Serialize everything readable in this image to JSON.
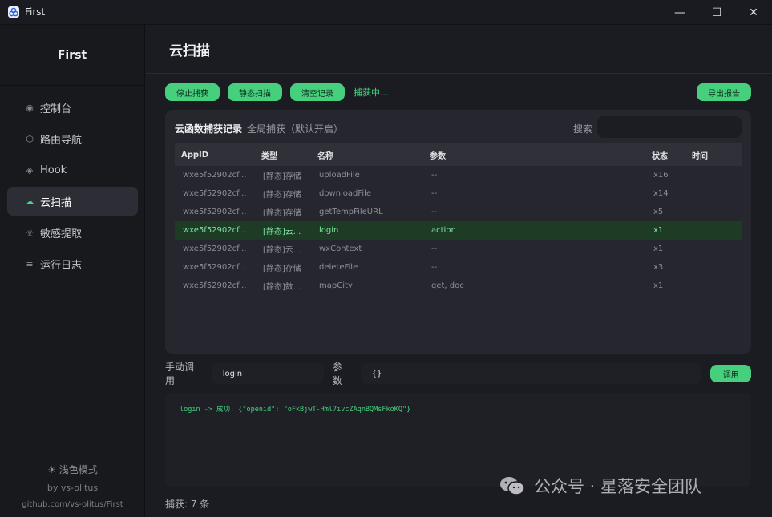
{
  "window": {
    "title": "First",
    "controls": {
      "minimize": "—",
      "maximize": "☐",
      "close": "✕"
    }
  },
  "sidebar": {
    "brand": "First",
    "items": [
      {
        "label": "控制台",
        "icon": "dot-icon",
        "glyph": "◉",
        "active": false
      },
      {
        "label": "路由导航",
        "icon": "hexagon-icon",
        "glyph": "⬡",
        "active": false
      },
      {
        "label": "Hook",
        "icon": "diamond-icon",
        "glyph": "◈",
        "active": false
      },
      {
        "label": "云扫描",
        "icon": "cloud-icon",
        "glyph": "☁",
        "active": true
      },
      {
        "label": "敏感提取",
        "icon": "biohazard-icon",
        "glyph": "☣",
        "active": false
      },
      {
        "label": "运行日志",
        "icon": "list-icon",
        "glyph": "≡",
        "active": false
      }
    ],
    "theme_toggle": "☀  浅色模式",
    "author": "by vs-olitus",
    "repo": "github.com/vs-olitus/First"
  },
  "page": {
    "title": "云扫描",
    "toolbar": {
      "stop": "停止捕获",
      "static_scan": "静态扫描",
      "clear": "清空记录",
      "status": "捕获中...",
      "export": "导出报告"
    },
    "panel": {
      "title": "云函数捕获记录",
      "subtitle": "全局捕获（默认开启）",
      "search_label": "搜索",
      "search_value": ""
    },
    "table": {
      "headers": [
        "AppID",
        "类型",
        "名称",
        "参数",
        "状态",
        "时间"
      ],
      "rows": [
        {
          "appid": "wxe5f52902cf...",
          "type": "[静态]存储",
          "name": "uploadFile",
          "params": "--",
          "status": "x16",
          "time": "",
          "selected": false
        },
        {
          "appid": "wxe5f52902cf...",
          "type": "[静态]存储",
          "name": "downloadFile",
          "params": "--",
          "status": "x14",
          "time": "",
          "selected": false
        },
        {
          "appid": "wxe5f52902cf...",
          "type": "[静态]存储",
          "name": "getTempFileURL",
          "params": "--",
          "status": "x5",
          "time": "",
          "selected": false
        },
        {
          "appid": "wxe5f52902cf...",
          "type": "[静态]云...",
          "name": "login",
          "params": "action",
          "status": "x1",
          "time": "",
          "selected": true
        },
        {
          "appid": "wxe5f52902cf...",
          "type": "[静态]云...",
          "name": "wxContext",
          "params": "--",
          "status": "x1",
          "time": "",
          "selected": false
        },
        {
          "appid": "wxe5f52902cf...",
          "type": "[静态]存储",
          "name": "deleteFile",
          "params": "--",
          "status": "x3",
          "time": "",
          "selected": false
        },
        {
          "appid": "wxe5f52902cf...",
          "type": "[静态]数...",
          "name": "mapCity",
          "params": "get, doc",
          "status": "x1",
          "time": "",
          "selected": false
        }
      ]
    },
    "invoke": {
      "label": "手动调用",
      "function_value": "login",
      "params_label": "参数",
      "params_value": "{}",
      "call_button": "调用"
    },
    "output": "login -> 成功: {\"openid\": \"oFkBjwT-Hml7ivcZAqnBQMsFkoKQ\"}",
    "count": "捕获: 7 条"
  },
  "watermark": {
    "text": "公众号 · 星落安全团队"
  },
  "colors": {
    "accent": "#46d07e",
    "selected_row": "#1e3b26",
    "background": "#1b1c22",
    "panel": "#26272e"
  }
}
